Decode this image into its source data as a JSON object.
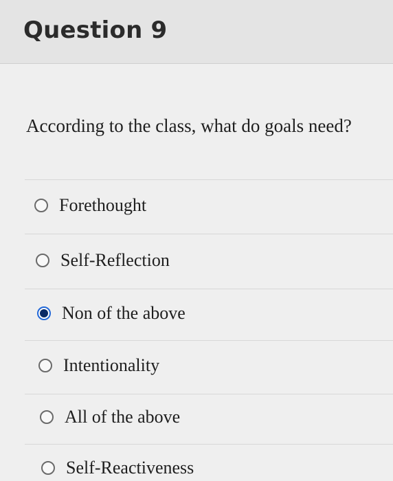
{
  "question": {
    "title": "Question 9",
    "prompt": "According to the class, what do goals need?",
    "options": [
      {
        "label": "Forethought",
        "selected": false
      },
      {
        "label": "Self-Reflection",
        "selected": false
      },
      {
        "label": "Non of the above",
        "selected": true
      },
      {
        "label": "Intentionality",
        "selected": false
      },
      {
        "label": "All of the above",
        "selected": false
      },
      {
        "label": "Self-Reactiveness",
        "selected": false
      }
    ]
  },
  "colors": {
    "selected_radio": "#2268d8"
  }
}
